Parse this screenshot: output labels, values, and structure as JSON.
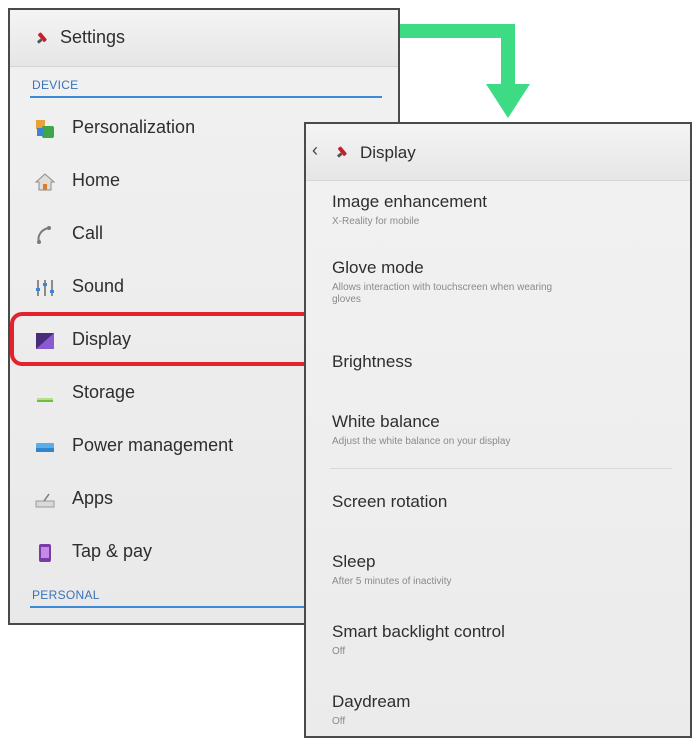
{
  "settings": {
    "title": "Settings",
    "icon": "settings-wrench-icon",
    "section_device": "DEVICE",
    "section_personal": "PERSONAL",
    "items": [
      {
        "label": "Personalization",
        "icon": "personalization-icon"
      },
      {
        "label": "Home",
        "icon": "home-icon"
      },
      {
        "label": "Call",
        "icon": "call-icon"
      },
      {
        "label": "Sound",
        "icon": "sound-icon"
      },
      {
        "label": "Display",
        "icon": "display-icon"
      },
      {
        "label": "Storage",
        "icon": "storage-icon"
      },
      {
        "label": "Power management",
        "icon": "battery-icon"
      },
      {
        "label": "Apps",
        "icon": "apps-icon"
      },
      {
        "label": "Tap & pay",
        "icon": "tap-pay-icon"
      }
    ],
    "highlighted_item": "Display"
  },
  "display": {
    "title": "Display",
    "back_icon": "chevron-left-icon",
    "items": [
      {
        "title": "Image enhancement",
        "summary": "X-Reality for mobile"
      },
      {
        "title": "Glove mode",
        "summary": "Allows interaction with touchscreen when wearing gloves"
      },
      {
        "title": "Brightness",
        "summary": ""
      },
      {
        "title": "White balance",
        "summary": "Adjust the white balance on your display"
      },
      {
        "title": "Screen rotation",
        "summary": ""
      },
      {
        "title": "Sleep",
        "summary": "After 5 minutes of inactivity"
      },
      {
        "title": "Smart backlight control",
        "summary": "Off"
      },
      {
        "title": "Daydream",
        "summary": "Off"
      }
    ]
  },
  "colors": {
    "highlight": "#e3232b",
    "arrow": "#3ddc84",
    "section_accent": "#3d8bd6"
  }
}
